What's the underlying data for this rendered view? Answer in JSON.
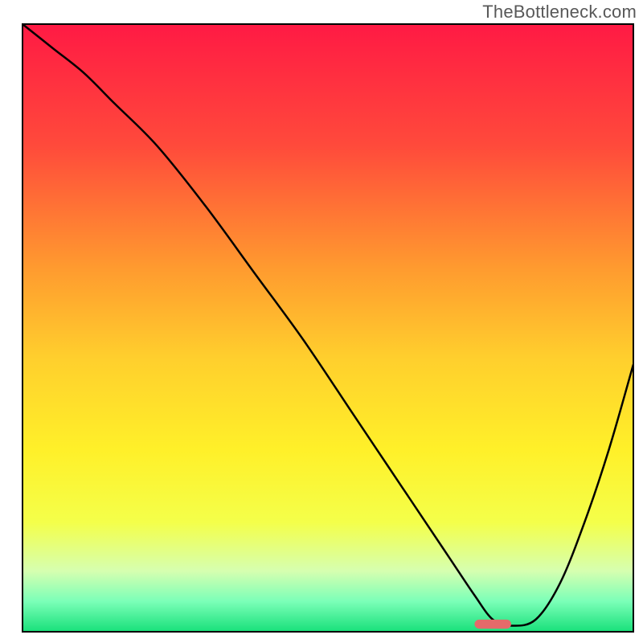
{
  "watermark": "TheBottleneck.com",
  "chart_data": {
    "type": "line",
    "title": "",
    "xlabel": "",
    "ylabel": "",
    "xlim": [
      0,
      100
    ],
    "ylim": [
      0,
      100
    ],
    "background_gradient": {
      "stops": [
        {
          "offset": 0,
          "color": "#ff1a44"
        },
        {
          "offset": 20,
          "color": "#ff4a3b"
        },
        {
          "offset": 40,
          "color": "#ff9a2f"
        },
        {
          "offset": 55,
          "color": "#ffcf2d"
        },
        {
          "offset": 70,
          "color": "#fff029"
        },
        {
          "offset": 82,
          "color": "#f4ff4a"
        },
        {
          "offset": 90,
          "color": "#d6ffb0"
        },
        {
          "offset": 95,
          "color": "#7bffb8"
        },
        {
          "offset": 100,
          "color": "#18e07a"
        }
      ]
    },
    "series": [
      {
        "name": "bottleneck-curve",
        "color": "#000000",
        "width": 2.5,
        "x": [
          0,
          5,
          10,
          15,
          22,
          30,
          38,
          46,
          54,
          60,
          66,
          70,
          74,
          77,
          80,
          84,
          88,
          92,
          96,
          100
        ],
        "y": [
          100,
          96,
          92,
          87,
          80,
          70,
          59,
          48,
          36,
          27,
          18,
          12,
          6,
          2,
          1,
          2,
          8,
          18,
          30,
          44
        ]
      }
    ],
    "markers": [
      {
        "name": "optimal-range",
        "type": "rounded-bar",
        "color": "#e46a6a",
        "x_start": 74,
        "x_end": 80,
        "y": 0.5,
        "height": 1.5
      }
    ],
    "frame": {
      "color": "#000000",
      "width": 2
    }
  }
}
